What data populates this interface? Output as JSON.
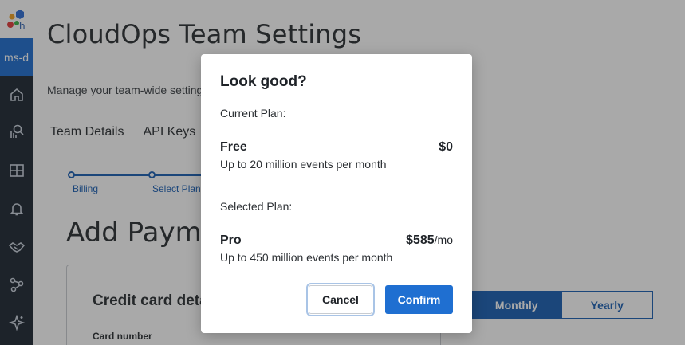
{
  "sidebar": {
    "team_chip": "ms-d",
    "icons": [
      "home-icon",
      "search-analytics-icon",
      "dashboard-grid-icon",
      "bell-icon",
      "handshake-icon",
      "graph-nodes-icon",
      "sparkle-icon"
    ]
  },
  "page": {
    "title": "CloudOps Team Settings",
    "subtitle": "Manage your team-wide settings",
    "tabs": [
      "Team Details",
      "API Keys"
    ],
    "steps": [
      "Billing",
      "Select Plan"
    ],
    "section_title": "Add Payment",
    "card_title": "Credit card details",
    "card_number_label": "Card number",
    "billing_toggle": {
      "monthly": "Monthly",
      "yearly": "Yearly",
      "selected": "Monthly"
    }
  },
  "modal": {
    "title": "Look good?",
    "current_label": "Current Plan:",
    "current_plan": {
      "name": "Free",
      "price": "$0",
      "desc": "Up to 20 million events per month"
    },
    "selected_label": "Selected Plan:",
    "selected_plan": {
      "name": "Pro",
      "price": "$585",
      "unit": "/mo",
      "desc": "Up to 450 million events per month"
    },
    "cancel_label": "Cancel",
    "confirm_label": "Confirm"
  },
  "colors": {
    "accent": "#1f6fd1",
    "rail": "#1d2733"
  }
}
